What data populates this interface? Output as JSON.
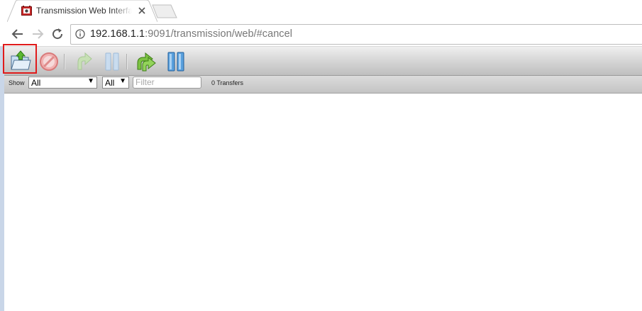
{
  "tab": {
    "title": "Transmission Web Interface"
  },
  "address": {
    "host": "192.168.1.1",
    "rest": ":9091/transmission/web/#cancel"
  },
  "toolbar": {
    "buttons": [
      "open-torrent",
      "remove-torrent",
      "resume",
      "pause",
      "resume-all",
      "pause-all"
    ]
  },
  "filterbar": {
    "show_label": "Show",
    "status_select": "All",
    "tracker_select": "All",
    "filter_placeholder": "Filter",
    "transfer_count": "0 Transfers"
  },
  "colors": {
    "highlight": "#e01b1b",
    "toolbar_gradient_top": "#efefef",
    "toolbar_gradient_bottom": "#bfbfbf"
  }
}
